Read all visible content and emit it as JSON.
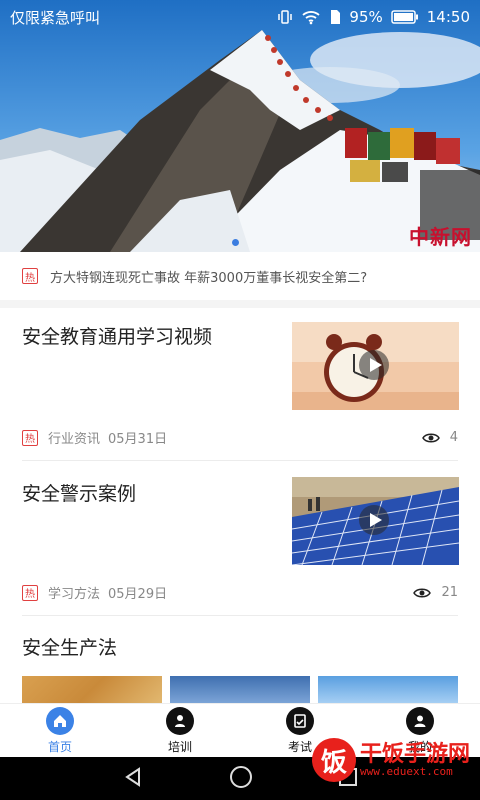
{
  "status_bar": {
    "carrier_text": "仅限紧急呼叫",
    "battery_percent": "95%",
    "time": "14:50"
  },
  "banner": {
    "watermark": "中新网"
  },
  "ticker": {
    "badge": "热",
    "text": "方大特钢连现死亡事故 年薪3000万董事长视安全第二?"
  },
  "cards": [
    {
      "title": "安全教育通用学习视频",
      "badge": "热",
      "category": "行业资讯",
      "date": "05月31日",
      "views": "4"
    },
    {
      "title": "安全警示案例",
      "badge": "热",
      "category": "学习方法",
      "date": "05月29日",
      "views": "21"
    }
  ],
  "section": {
    "title": "安全生产法"
  },
  "bottom_nav": {
    "items": [
      {
        "label": "首页",
        "icon": "home-icon",
        "active": true
      },
      {
        "label": "培训",
        "icon": "training-icon",
        "active": false
      },
      {
        "label": "考试",
        "icon": "exam-icon",
        "active": false
      },
      {
        "label": "我的",
        "icon": "profile-icon",
        "active": false
      }
    ]
  },
  "watermark_site": {
    "logo": "饭",
    "name": "干饭手游网",
    "url": "www.eduext.com"
  },
  "colors": {
    "accent": "#3b82e6",
    "hot_badge": "#e04040",
    "watermark": "#e8211c"
  }
}
